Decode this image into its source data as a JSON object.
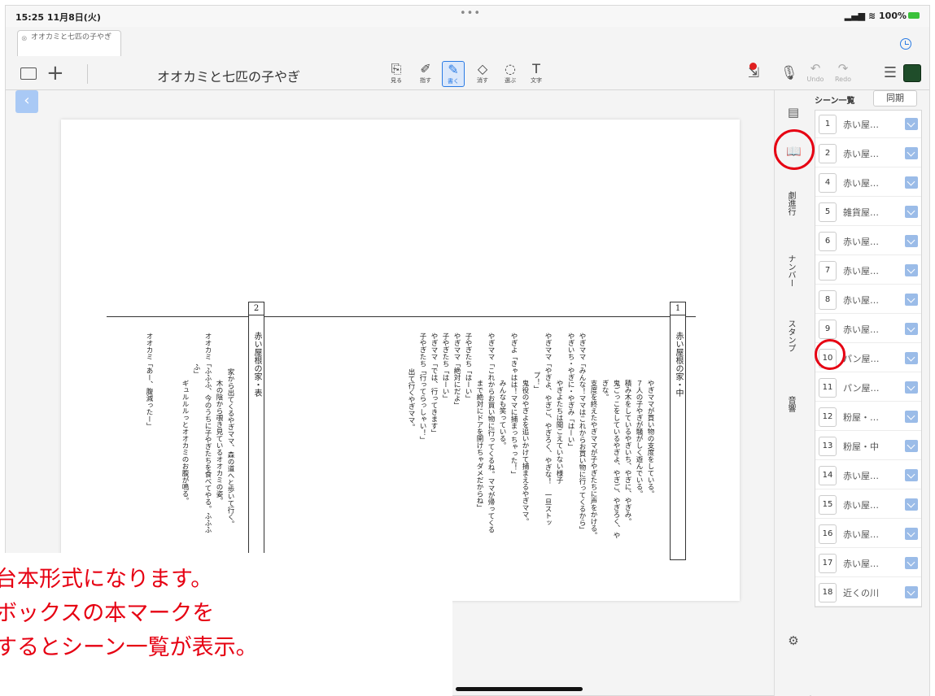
{
  "status": {
    "time": "15:25  11月8日(火)",
    "dots": "•••",
    "battery": "100%"
  },
  "doc_tab": {
    "label": "オオカミと七匹の子やぎ"
  },
  "toolbar": {
    "title": "オオカミと七匹の子やぎ",
    "tools": [
      "見る",
      "指す",
      "書く",
      "消す",
      "選ぶ",
      "文字"
    ],
    "active_tool": "書く",
    "undo_label": "Undo",
    "redo_label": "Redo"
  },
  "side_tabs": [
    "劇進行",
    "ナンバー",
    "スタンプ",
    "音響"
  ],
  "scene_panel": {
    "title": "シーン一覧",
    "sync_label": "同期",
    "scenes": [
      {
        "num": "1",
        "name": "赤い屋…"
      },
      {
        "num": "2",
        "name": "赤い屋…"
      },
      {
        "num": "4",
        "name": "赤い屋…"
      },
      {
        "num": "5",
        "name": "雑貨屋…"
      },
      {
        "num": "6",
        "name": "赤い屋…"
      },
      {
        "num": "7",
        "name": "赤い屋…"
      },
      {
        "num": "8",
        "name": "赤い屋…"
      },
      {
        "num": "9",
        "name": "赤い屋…"
      },
      {
        "num": "10",
        "name": "パン屋…"
      },
      {
        "num": "11",
        "name": "パン屋…"
      },
      {
        "num": "12",
        "name": "粉屋・…"
      },
      {
        "num": "13",
        "name": "粉屋・中"
      },
      {
        "num": "14",
        "name": "赤い屋…"
      },
      {
        "num": "15",
        "name": "赤い屋…"
      },
      {
        "num": "16",
        "name": "赤い屋…"
      },
      {
        "num": "17",
        "name": "赤い屋…"
      },
      {
        "num": "18",
        "name": "近くの川"
      }
    ]
  },
  "script": {
    "scene1": {
      "num": "1",
      "title": "赤い屋根の家・中"
    },
    "scene2": {
      "num": "2",
      "title": "赤い屋根の家・表"
    },
    "scene1_lines": [
      "やぎママが買い物の支度をしている。",
      "７人の子やぎが騒がしく遊んでいる。",
      "積み木をしているやぎいち、やぎに、やぎみ。",
      "鬼ごっこをしているやぎよ、やぎご、やぎろく、や",
      "ぎな。",
      "支度を終えたやぎママが子やぎたちに声をかける。",
      "やぎママ「みんな！ママはこれからお買い物に行ってくるから」",
      "やぎいち・やぎに・やぎみ「はーい」",
      "やぎよたちは聞こえていない様子",
      "やぎママ「やぎよ、やぎご、やぎろく、やぎな！　一旦ストッ",
      "プ！」",
      "鬼役のやぎよを追いかけて捕まえるやぎママ。",
      "やぎよ「きゃはは！ママに捕まっちゃった！」",
      "みんなも笑っている。",
      "やぎママ「これからお買い物に行ってくるね。ママが帰ってくる",
      "まで絶対にドアを開けちゃダメだからね」",
      "子やぎたち「はーい」",
      "やぎママ「絶対にだよ」",
      "子やぎたち「はーい」",
      "やぎママ「では、行ってきます」",
      "子やぎたち「行ってらっしゃい！」",
      "出て行くやぎママ。"
    ],
    "scene2_lines": [
      "家から出てくるやぎママ、森の道へと歩いて行く。",
      "木の陰から覗き見ているオオカミの姿。",
      "オオカミ「ふふふ、今のうちに子やぎたちを食べてやる。ふふふ",
      "ふ」",
      "ギュルルルっとオオカミのお腹が鳴る。",
      "オオカミ「あー、腹減ったー」"
    ]
  },
  "caption": [
    "台本形式になります。",
    "ボックスの本マークを",
    "するとシーン一覧が表示。"
  ],
  "colors": {
    "accent": "#2a7be4",
    "annotation": "#e60012"
  }
}
